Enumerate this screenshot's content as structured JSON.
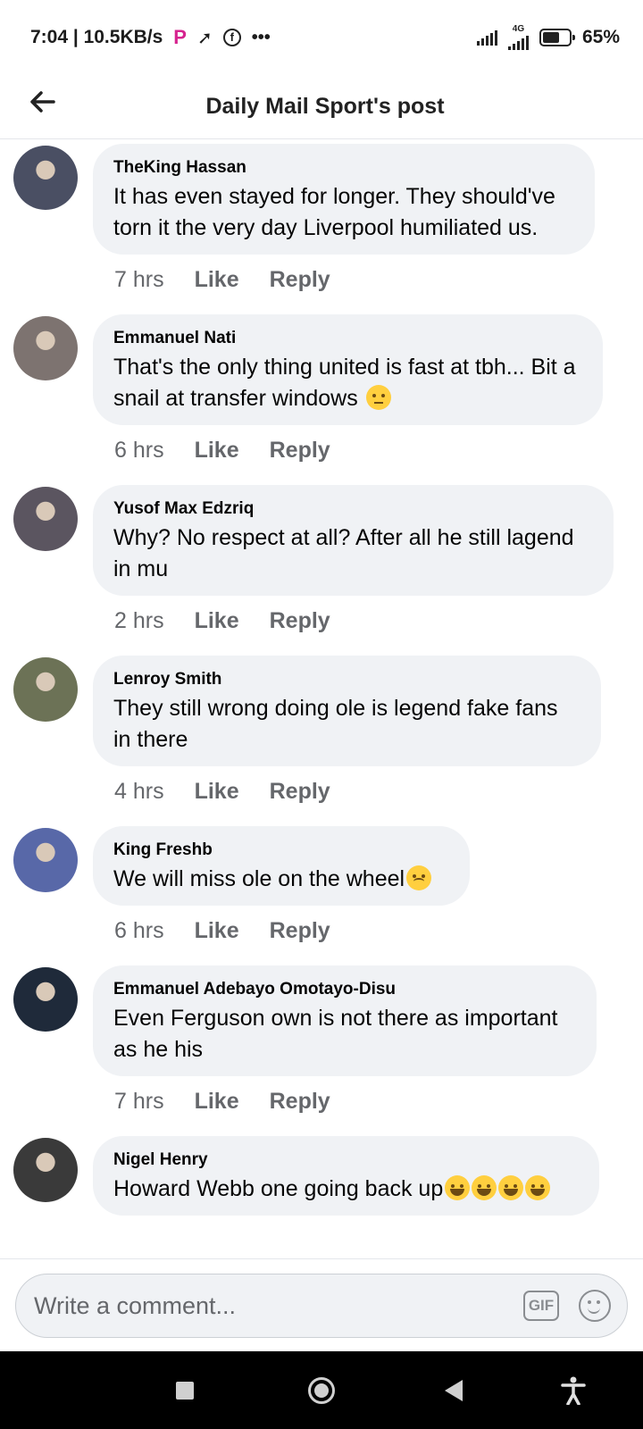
{
  "status_bar": {
    "time_speed": "7:04 | 10.5KB/s",
    "icons": [
      "pinterest-p-icon",
      "bird-icon",
      "facebook-icon",
      "more-dots-icon"
    ],
    "network": "4G",
    "battery": "65%",
    "battery_level": 0.65
  },
  "header": {
    "back_icon": "arrow-left-icon",
    "title": "Daily Mail Sport's post"
  },
  "comments": [
    {
      "author": "TheKing Hassan",
      "text": "It has even stayed for longer. They should've torn it the very day Liverpool humiliated us.",
      "time": "7 hrs",
      "like": "Like",
      "reply": "Reply",
      "avatar_color": "#4a4f63",
      "emoji": ""
    },
    {
      "author": "Emmanuel Nati",
      "text": "That's the only thing united is fast at tbh... Bit a snail at transfer windows",
      "time": "6 hrs",
      "like": "Like",
      "reply": "Reply",
      "avatar_color": "#7d7370",
      "emoji": "rolling-eyes"
    },
    {
      "author": "Yusof Max Edzriq",
      "text": "Why? No respect at all? After all he still lagend in mu",
      "time": "2 hrs",
      "like": "Like",
      "reply": "Reply",
      "avatar_color": "#5b5560",
      "emoji": ""
    },
    {
      "author": "Lenroy Smith",
      "text": "They still wrong doing ole is legend fake fans in there",
      "time": "4 hrs",
      "like": "Like",
      "reply": "Reply",
      "avatar_color": "#6c7256",
      "emoji": ""
    },
    {
      "author": "King Freshb",
      "text": "We will miss ole on the wheel",
      "time": "6 hrs",
      "like": "Like",
      "reply": "Reply",
      "avatar_color": "#5868a8",
      "emoji": "sad"
    },
    {
      "author": "Emmanuel Adebayo Omotayo-Disu",
      "text": "Even Ferguson own is not there as important as he his",
      "time": "7 hrs",
      "like": "Like",
      "reply": "Reply",
      "avatar_color": "#1f2a3a",
      "emoji": ""
    },
    {
      "author": "Nigel Henry",
      "text": "Howard Webb one going back up",
      "time": "",
      "like": "",
      "reply": "",
      "avatar_color": "#3a3a3a",
      "emoji": "laugh4"
    }
  ],
  "composer": {
    "placeholder": "Write a comment...",
    "gif_label": "GIF",
    "emoji_icon": "smiley-icon"
  },
  "nav_bar": {
    "icons": [
      "recent-apps-icon",
      "home-icon",
      "back-icon",
      "accessibility-icon"
    ]
  }
}
